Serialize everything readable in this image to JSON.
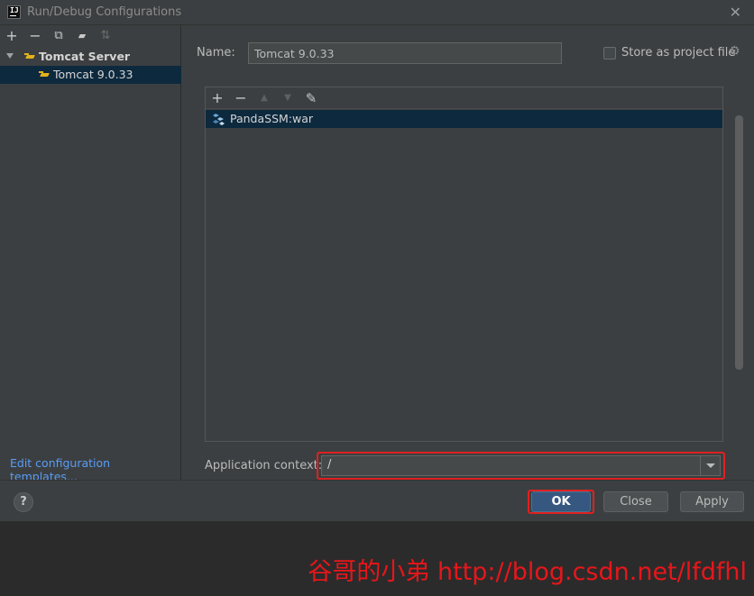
{
  "window": {
    "title": "Run/Debug Configurations",
    "app_icon_text": "IJ"
  },
  "left_toolbar": {
    "add": "+",
    "remove": "−",
    "copy": "⧉",
    "folder": "▰",
    "sort": "⇅"
  },
  "tree": {
    "group_label": "Tomcat Server",
    "item_label": "Tomcat 9.0.33"
  },
  "edit_templates_link": "Edit configuration templates...",
  "form": {
    "name_label": "Name:",
    "name_value": "Tomcat 9.0.33",
    "store_label": "Store as project file",
    "store_checked": false
  },
  "deploy_toolbar": {
    "add": "+",
    "remove": "−",
    "up": "▲",
    "down": "▼",
    "edit": "✎"
  },
  "deployments": [
    "PandaSSM:war"
  ],
  "app_context": {
    "label": "Application context:",
    "value": "/"
  },
  "buttons": {
    "help": "?",
    "ok": "OK",
    "close": "Close",
    "apply": "Apply"
  },
  "watermark": "谷哥的小弟 http://blog.csdn.net/lfdfhl",
  "colors": {
    "accent_selection": "#0d293e",
    "primary_button": "#365880",
    "highlight_box": "#e02020",
    "link": "#589df6"
  }
}
